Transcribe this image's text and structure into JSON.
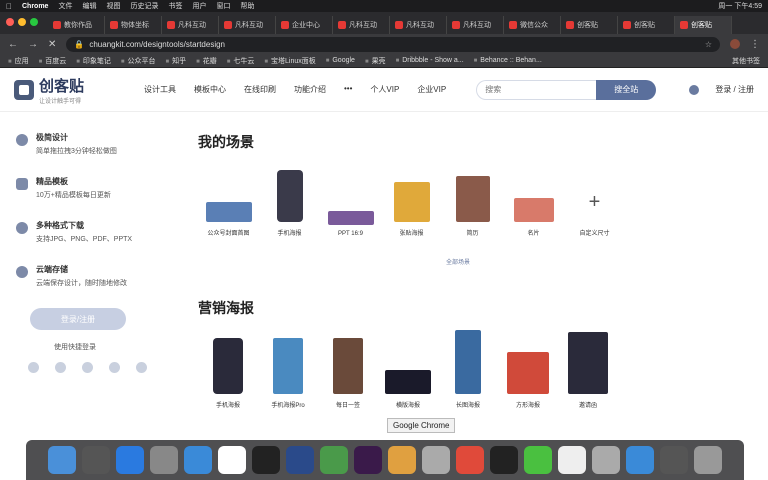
{
  "menubar": {
    "app": "Chrome",
    "items": [
      "文件",
      "编辑",
      "视图",
      "历史记录",
      "书签",
      "用户",
      "窗口",
      "帮助"
    ],
    "clock": "周一 下午4:59"
  },
  "tabs": [
    {
      "label": "教你作品"
    },
    {
      "label": "物体坐标"
    },
    {
      "label": "凡科互动"
    },
    {
      "label": "凡科互动"
    },
    {
      "label": "企业中心"
    },
    {
      "label": "凡科互动"
    },
    {
      "label": "凡科互动"
    },
    {
      "label": "凡科互动"
    },
    {
      "label": "微信公众"
    },
    {
      "label": "创客贴"
    },
    {
      "label": "创客贴"
    },
    {
      "label": "创客贴",
      "active": true
    }
  ],
  "address": {
    "url": "chuangkit.com/designtools/startdesign"
  },
  "bookmarks": {
    "items": [
      "应用",
      "百度云",
      "印象笔记",
      "公众平台",
      "知乎",
      "花瓣",
      "七牛云",
      "宝塔Linux面板",
      "Google",
      "果壳",
      "Dribbble - Show a...",
      "Behance :: Behan..."
    ],
    "other": "其他书签"
  },
  "header": {
    "logo_name": "创客贴",
    "logo_slogan": "让设计触手可得",
    "nav": [
      "设计工具",
      "模板中心",
      "在线印刷",
      "功能介绍",
      "•••",
      "个人VIP",
      "企业VIP"
    ],
    "search_placeholder": "搜索",
    "search_button": "搜全站",
    "login": "登录 / 注册"
  },
  "sidebar": {
    "features": [
      {
        "title": "极简设计",
        "desc": "简单拖拉拽3分钟轻松做图"
      },
      {
        "title": "精品模板",
        "desc": "10万+精品模板每日更新"
      },
      {
        "title": "多种格式下载",
        "desc": "支持JPG、PNG、PDF、PPTX"
      },
      {
        "title": "云端存储",
        "desc": "云端保存设计，随时随地修改"
      }
    ],
    "login_button": "登录/注册",
    "quick_login_label": "使用快捷登录"
  },
  "main": {
    "scene_title": "我的场景",
    "scenes": [
      {
        "label": "公众号封面首图",
        "color": "#5a7fb5"
      },
      {
        "label": "手机海报",
        "color": "#3a3a4a"
      },
      {
        "label": "PPT 16:9",
        "color": "#7a5a9a"
      },
      {
        "label": "张贴海报",
        "color": "#e0a93a"
      },
      {
        "label": "简历",
        "color": "#8a5a4a"
      },
      {
        "label": "名片",
        "color": "#d87a6a"
      },
      {
        "label": "自定义尺寸",
        "color": "#ffffff"
      }
    ],
    "more_scenes": "全部场景",
    "poster_title": "营销海报",
    "posters": [
      {
        "label": "手机海报",
        "color": "#2a2a3a"
      },
      {
        "label": "手机海报Pro",
        "color": "#4a8ac0"
      },
      {
        "label": "每日一签",
        "color": "#6a4a3a"
      },
      {
        "label": "横版海报",
        "color": "#1a1a2a"
      },
      {
        "label": "长图海报",
        "color": "#3a6aa0"
      },
      {
        "label": "方形海报",
        "color": "#d04a3a"
      },
      {
        "label": "邀请函",
        "color": "#2a2a3a"
      }
    ]
  },
  "tooltip": "Google Chrome",
  "dock": {
    "apps": [
      "finder-icon",
      "launchpad-icon",
      "appstore-icon",
      "photos-icon",
      "safari-icon",
      "calendar-icon",
      "gitkraken-icon",
      "photoshop-icon",
      "chrome-icon",
      "premiere-icon",
      "keynote-icon",
      "preview-icon",
      "wps-icon",
      "qq-icon",
      "wechat-icon",
      "notes-icon",
      "sketch-icon",
      "baidu-netdisk-icon",
      "quicktime-icon",
      "trash-icon"
    ],
    "colors": [
      "#4a90d9",
      "#555",
      "#2a7ae0",
      "#888",
      "#3a8ad8",
      "#fff",
      "#222",
      "#2a4a8a",
      "#4a9a4a",
      "#3a1a4a",
      "#e0a040",
      "#aaa",
      "#e04a3a",
      "#222",
      "#4ac040",
      "#eee",
      "#aaa",
      "#3a8ad8",
      "#555",
      "#999"
    ]
  }
}
